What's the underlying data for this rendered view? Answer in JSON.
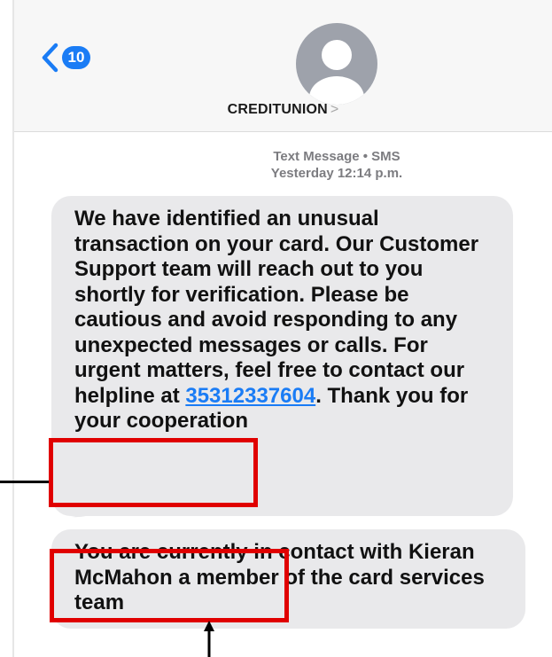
{
  "header": {
    "back_count": "10",
    "contact_name": "CREDITUNION",
    "contact_chevron": ">"
  },
  "meta": {
    "line1": "Text Message • SMS",
    "line2": "Yesterday 12:14 p.m."
  },
  "messages": [
    {
      "text_before": "We have identified an unusual transaction on your card. Our Customer Support team will reach out to you shortly for verification. Please be cautious and avoid responding to any unexpected messages or calls. For urgent matters, feel free to contact our helpline at ",
      "phone": "35312337604",
      "text_after": ". Thank you for your cooperation"
    },
    {
      "text": "You are currently in contact with Kieran McMahon a member of the card services team"
    }
  ],
  "colors": {
    "accent": "#1a7cf5",
    "bubble": "#e9e9eb",
    "highlight": "#e00000"
  }
}
